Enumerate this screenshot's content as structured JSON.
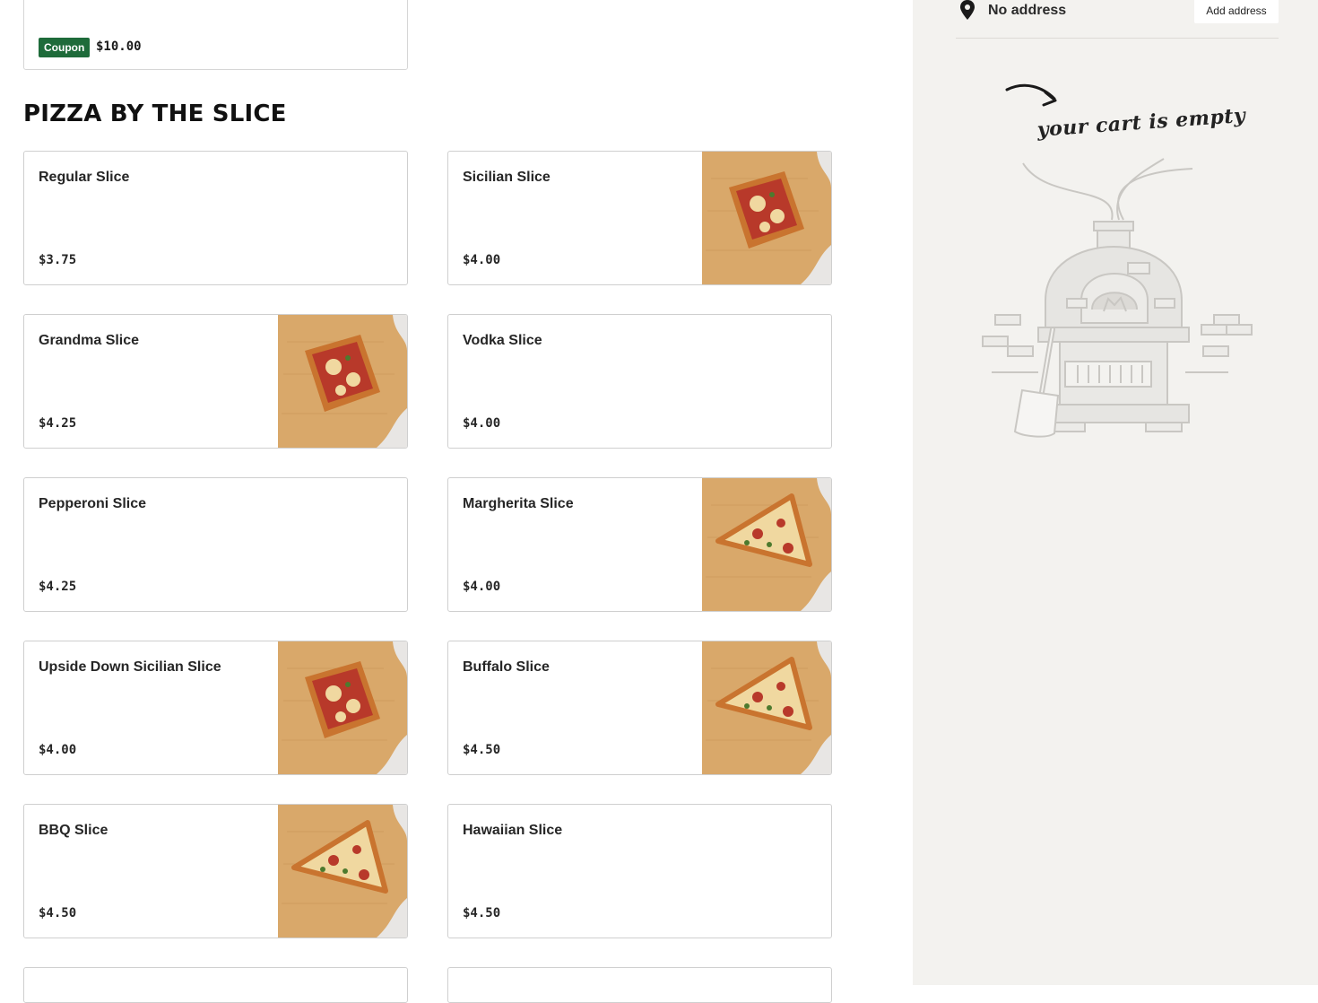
{
  "coupon": {
    "badge": "Coupon",
    "price": "$10.00"
  },
  "section": {
    "title": "PIZZA BY THE SLICE"
  },
  "items": [
    {
      "name": "Regular Slice",
      "price": "$3.75",
      "photo": false
    },
    {
      "name": "Sicilian Slice",
      "price": "$4.00",
      "photo": true,
      "photo_style": "square"
    },
    {
      "name": "Grandma Slice",
      "price": "$4.25",
      "photo": true,
      "photo_style": "square"
    },
    {
      "name": "Vodka Slice",
      "price": "$4.00",
      "photo": false
    },
    {
      "name": "Pepperoni Slice",
      "price": "$4.25",
      "photo": false
    },
    {
      "name": "Margherita Slice",
      "price": "$4.00",
      "photo": true,
      "photo_style": "triangle"
    },
    {
      "name": "Upside Down Sicilian Slice",
      "price": "$4.00",
      "photo": true,
      "photo_style": "square"
    },
    {
      "name": "Buffalo Slice",
      "price": "$4.50",
      "photo": true,
      "photo_style": "triangle"
    },
    {
      "name": "BBQ Slice",
      "price": "$4.50",
      "photo": true,
      "photo_style": "triangle"
    },
    {
      "name": "Hawaiian Slice",
      "price": "$4.50",
      "photo": false
    }
  ],
  "sidebar": {
    "address_text": "No address",
    "add_address_label": "Add address",
    "cart_empty_text": "your cart is empty"
  },
  "colors": {
    "coupon_badge": "#1e6b3a",
    "sidebar_bg": "#f3f2ef",
    "board": "#d9a86a",
    "crust": "#c9742f",
    "sauce": "#b8392a",
    "cheese": "#f0d8a0"
  },
  "icons": {
    "location": "map-pin-icon",
    "cart": "pizza-oven-illustration"
  }
}
